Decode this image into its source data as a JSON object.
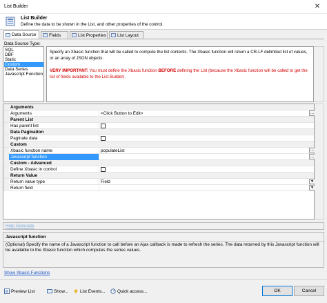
{
  "window": {
    "title": "List Builder",
    "close_glyph": "✕"
  },
  "header": {
    "title": "List Builder",
    "subtitle": "Define the data to be shown in the List, and other properties of the control."
  },
  "tabs": [
    {
      "label": "Data Source",
      "active": true
    },
    {
      "label": "Fields",
      "active": false
    },
    {
      "label": "List Properties",
      "active": false
    },
    {
      "label": "List Layout",
      "active": false
    }
  ],
  "data_source": {
    "label": "Data Source Type:",
    "items": [
      "SQL",
      "DBF",
      "Static",
      "Custom",
      "Data Series",
      "Javascript Function"
    ],
    "selected": "Custom"
  },
  "description": {
    "text": "Specify an Xbasic function that will be called to compute the list contents. The Xbasic function will return a CR-LF delimited list of values, or an array of JSON objects.",
    "important_label": "VERY IMPORTANT:",
    "important_text_1": " You must define the Xbasic function ",
    "important_before": "BEFORE",
    "important_text_2": " defining the List (because the Xbasic function will be called to get the list of fields available to the List Builder)."
  },
  "properties": {
    "cat_arguments": "Arguments",
    "arguments_name": "Arguments",
    "arguments_value": "<Click Button to Edit>",
    "cat_parent_list": "Parent List",
    "has_parent_list": "Has parent list",
    "cat_data_pagination": "Data Pagination",
    "paginate_data": "Paginate data",
    "cat_custom": "Custom",
    "xbasic_function_name": "Xbasic function name",
    "xbasic_function_value": "populateList",
    "javascript_function": "Javascript function",
    "cat_custom_advanced": "Custom - Advanced",
    "define_xbasic": "Define Xbasic in control",
    "cat_return_value": "Return Value",
    "return_value_type": "Return value type",
    "return_value_type_value": "Field",
    "return_field": "Return field",
    "button_dots": "...",
    "dropdown_glyph": "▼"
  },
  "help_generate": "Help Generate",
  "help": {
    "title": "Javascript function",
    "text": "(Optional) Specify the name of a Javascript function to call before an Ajax callback is made to refresh the series. The data returned by this Javascript function will be available to the Xbasic function which computes the series values."
  },
  "show_xbasic_link": "Show Xbasic Functions",
  "bottom_bar": {
    "preview": "Preview List",
    "show": "Show...",
    "events": "List Events...",
    "quick": "Quick access...",
    "ok": "OK",
    "cancel": "Cancel"
  },
  "colors": {
    "selection": "#3399ff",
    "important": "#d40000",
    "link": "#1a55cc"
  }
}
